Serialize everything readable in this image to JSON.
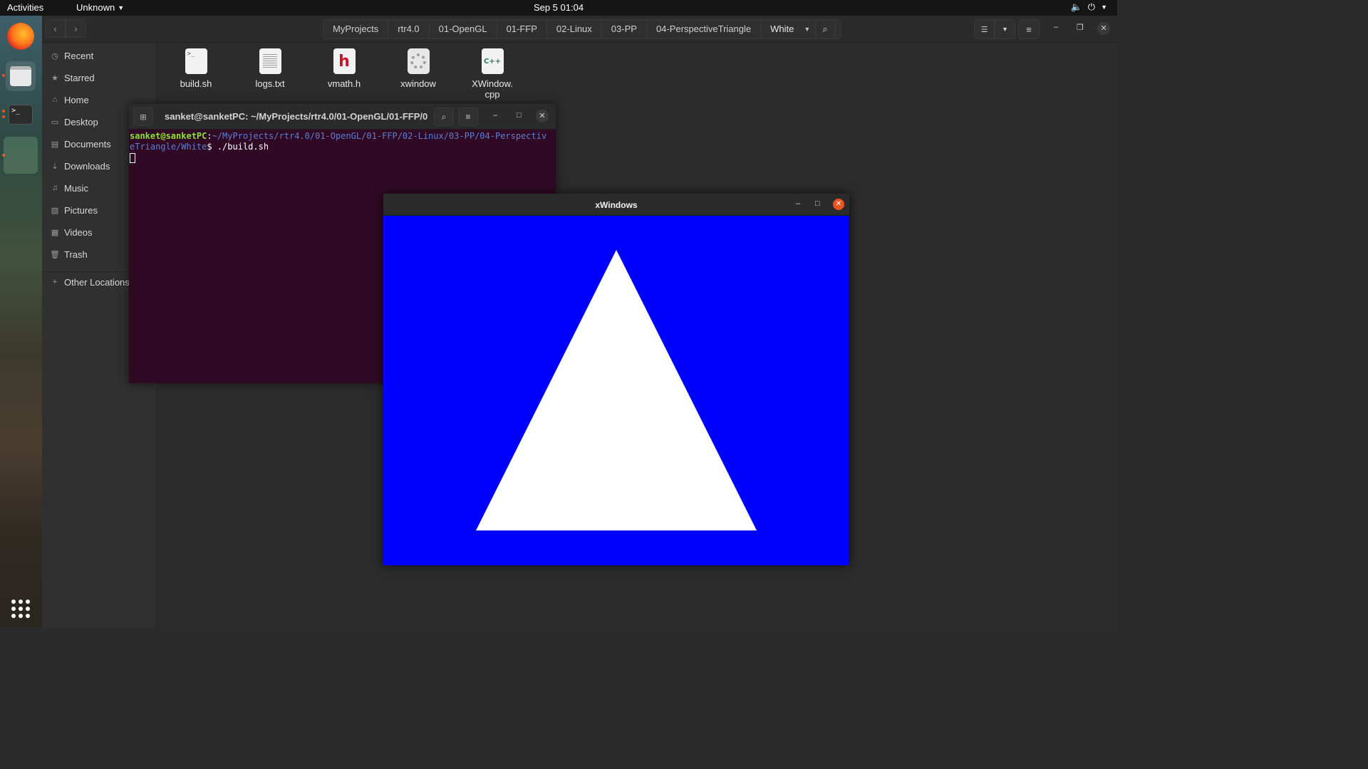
{
  "topbar": {
    "activities": "Activities",
    "app_menu": "Unknown",
    "clock": "Sep 5  01:04",
    "icons": [
      "volume-icon",
      "power-icon",
      "caret-down-icon"
    ]
  },
  "dock": {
    "apps": [
      "Firefox",
      "Files",
      "Terminal",
      "xWindows"
    ],
    "show_apps_icon": "grid-icon"
  },
  "file_manager": {
    "pathbar": [
      "MyProjects",
      "rtr4.0",
      "01-OpenGL",
      "01-FFP",
      "02-Linux",
      "03-PP",
      "04-PerspectiveTriangle",
      "White"
    ],
    "sidebar": [
      {
        "label": "Recent",
        "icon": "clock-icon"
      },
      {
        "label": "Starred",
        "icon": "star-icon"
      },
      {
        "label": "Home",
        "icon": "home-icon"
      },
      {
        "label": "Desktop",
        "icon": "desktop-icon"
      },
      {
        "label": "Documents",
        "icon": "document-icon"
      },
      {
        "label": "Downloads",
        "icon": "download-icon"
      },
      {
        "label": "Music",
        "icon": "music-icon"
      },
      {
        "label": "Pictures",
        "icon": "picture-icon"
      },
      {
        "label": "Videos",
        "icon": "video-icon"
      },
      {
        "label": "Trash",
        "icon": "trash-icon"
      }
    ],
    "other_locations": "Other Locations",
    "files": [
      {
        "name": "build.sh",
        "icon_text": ">_"
      },
      {
        "name": "logs.txt"
      },
      {
        "name": "vmath.h",
        "icon_text": "h"
      },
      {
        "name": "xwindow"
      },
      {
        "name_line1": "XWindow.",
        "name_line2": "cpp",
        "icon_text": "C++"
      }
    ]
  },
  "terminal": {
    "title": "sanket@sanketPC: ~/MyProjects/rtr4.0/01-OpenGL/01-FFP/0...",
    "prompt_user": "sanket@sanketPC",
    "prompt_sep": ":",
    "prompt_path": "~/MyProjects/rtr4.0/01-OpenGL/01-FFP/02-Linux/03-PP/04-PerspectiveTriangle/White",
    "prompt_symbol": "$",
    "command": " ./build.sh"
  },
  "xwindow": {
    "title": "xWindows",
    "background_color": "#0000ff",
    "triangle_color": "#ffffff"
  },
  "colors": {
    "accent": "#e95420",
    "terminal_bg": "#300a24",
    "prompt_user": "#8ae234",
    "prompt_path": "#5c7fd1"
  }
}
